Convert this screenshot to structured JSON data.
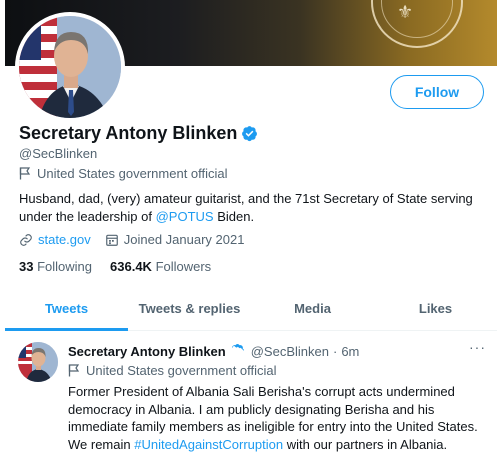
{
  "banner": {
    "seal_mark": "⚜"
  },
  "profile": {
    "name": "Secretary Antony Blinken",
    "handle": "@SecBlinken",
    "official_label": "United States government official",
    "bio_prefix": "Husband, dad, (very) amateur guitarist, and the 71st Secretary of State serving under the leadership of ",
    "bio_mention": "@POTUS",
    "bio_suffix": " Biden.",
    "website": "state.gov",
    "joined": "Joined January 2021",
    "following_count": "33",
    "following_label": "Following",
    "followers_count": "636.4K",
    "followers_label": "Followers"
  },
  "actions": {
    "follow_label": "Follow"
  },
  "tabs": [
    {
      "label": "Tweets",
      "active": true
    },
    {
      "label": "Tweets & replies",
      "active": false
    },
    {
      "label": "Media",
      "active": false
    },
    {
      "label": "Likes",
      "active": false
    }
  ],
  "tweet": {
    "name": "Secretary Antony Blinken",
    "handle": "@SecBlinken",
    "separator": "·",
    "time": "6m",
    "official_label": "United States government official",
    "text_before": "Former President of Albania Sali Berisha's corrupt acts undermined democracy in Albania. I am publicly designating Berisha and his immediate family members as ineligible for entry into the United States. We remain ",
    "hashtag": "#UnitedAgainstCorruption",
    "text_after": " with our partners in Albania.",
    "more_label": "···"
  },
  "colors": {
    "accent": "#1d9bf0",
    "muted": "#536471",
    "text": "#0f1419"
  }
}
